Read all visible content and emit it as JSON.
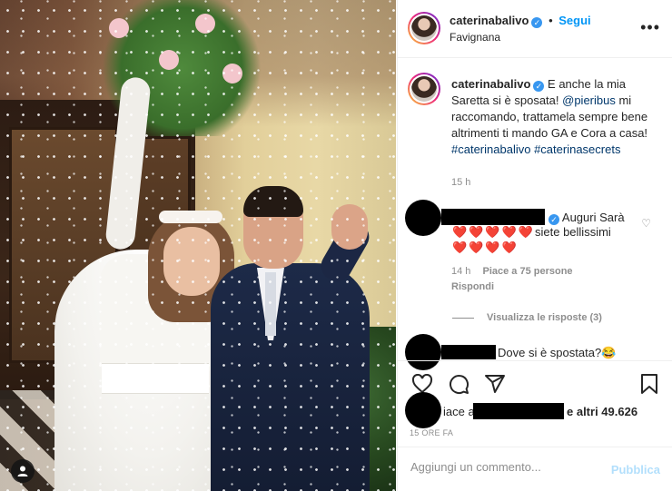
{
  "post": {
    "username": "caterinabalivo",
    "follow_label": "Segui",
    "location": "Favignana",
    "more_icon": "•••"
  },
  "caption": {
    "username": "caterinabalivo",
    "text_1": " E anche la mia Saretta si è sposata! ",
    "mention": "@pieribus",
    "text_2": " mi raccomando, trattamela sempre bene altrimenti ti mando GA e Cora a casa! ",
    "hashtag_1": "#caterinabalivo",
    "hashtag_2": "#caterinasecrets",
    "time": "15 h"
  },
  "comments": [
    {
      "text_1": "Auguri Sarà",
      "hearts_1": "❤️❤️❤️❤️❤️",
      "hearts_2": "❤️❤️❤️❤️",
      "text_2": "siete bellissimi",
      "time": "14 h",
      "likes": "Piace a 75 persone",
      "reply": "Rispondi"
    },
    {
      "text": "Dove si è spostata?😂"
    }
  ],
  "view_replies": "Visualizza le risposte (3)",
  "likes_line": {
    "prefix": "iace a",
    "others": "e altri 49.626"
  },
  "post_time": "15 ORE FA",
  "add_comment": {
    "placeholder": "Aggiungi un commento...",
    "publish": "Pubblica"
  },
  "colors": {
    "accent": "#0095f6",
    "verified": "#3897f0",
    "muted": "#8e8e8e",
    "publish_disabled": "#b2dffc"
  }
}
